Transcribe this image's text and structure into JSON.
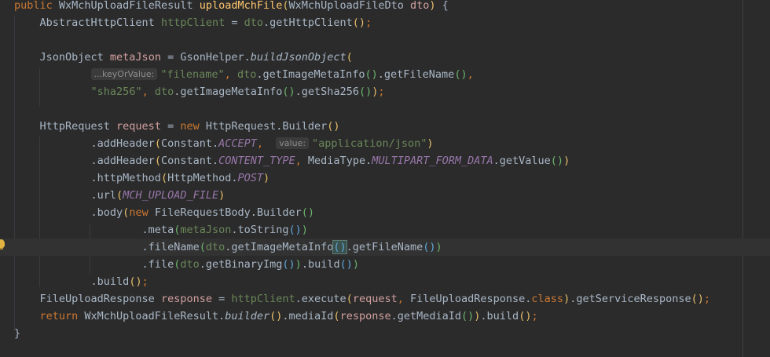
{
  "editor": {
    "lines": [
      {
        "tokens": [
          {
            "t": "public ",
            "c": "kw"
          },
          {
            "t": "WxMchUploadFileResult ",
            "c": "var"
          },
          {
            "t": "uploadMchFile",
            "c": "fn"
          },
          {
            "t": "(",
            "c": "p1"
          },
          {
            "t": "WxMchUploadFileDto ",
            "c": "var"
          },
          {
            "t": "dto",
            "c": "local"
          },
          {
            "t": ")",
            "c": "p1"
          },
          {
            "t": " {",
            "c": "var"
          }
        ]
      },
      {
        "tokens": [
          {
            "t": "    AbstractHttpClient ",
            "c": "var"
          },
          {
            "t": "httpClient",
            "c": "str"
          },
          {
            "t": " = ",
            "c": "var"
          },
          {
            "t": "dto",
            "c": "str"
          },
          {
            "t": ".getHttpClient",
            "c": "var"
          },
          {
            "t": "()",
            "c": "p1"
          },
          {
            "t": ";",
            "c": "kw"
          }
        ]
      },
      {
        "tokens": []
      },
      {
        "tokens": [
          {
            "t": "    JsonObject ",
            "c": "var"
          },
          {
            "t": "metaJson",
            "c": "local"
          },
          {
            "t": " = GsonHelper.",
            "c": "var"
          },
          {
            "t": "buildJsonObject",
            "c": "static"
          },
          {
            "t": "(",
            "c": "p1"
          }
        ]
      },
      {
        "tokens": [
          {
            "t": "            ",
            "c": "var"
          },
          {
            "t": "...keyOrValue:",
            "c": "hint"
          },
          {
            "t": "\"filename\"",
            "c": "str"
          },
          {
            "t": ", ",
            "c": "kw"
          },
          {
            "t": "dto",
            "c": "str"
          },
          {
            "t": ".getImageMetaInfo",
            "c": "var"
          },
          {
            "t": "()",
            "c": "p2"
          },
          {
            "t": ".getFileName",
            "c": "var"
          },
          {
            "t": "()",
            "c": "p2"
          },
          {
            "t": ",",
            "c": "kw"
          }
        ]
      },
      {
        "tokens": [
          {
            "t": "            ",
            "c": "var"
          },
          {
            "t": "\"sha256\"",
            "c": "str"
          },
          {
            "t": ", ",
            "c": "kw"
          },
          {
            "t": "dto",
            "c": "str"
          },
          {
            "t": ".getImageMetaInfo",
            "c": "var"
          },
          {
            "t": "()",
            "c": "p2"
          },
          {
            "t": ".getSha256",
            "c": "var"
          },
          {
            "t": "()",
            "c": "p2"
          },
          {
            "t": ")",
            "c": "p1"
          },
          {
            "t": ";",
            "c": "kw"
          }
        ]
      },
      {
        "tokens": []
      },
      {
        "tokens": [
          {
            "t": "    HttpRequest ",
            "c": "var"
          },
          {
            "t": "request",
            "c": "local"
          },
          {
            "t": " = ",
            "c": "var"
          },
          {
            "t": "new ",
            "c": "kw"
          },
          {
            "t": "HttpRequest.Builder",
            "c": "var"
          },
          {
            "t": "()",
            "c": "p1"
          }
        ]
      },
      {
        "tokens": [
          {
            "t": "            .addHeader",
            "c": "var"
          },
          {
            "t": "(",
            "c": "p1"
          },
          {
            "t": "Constant.",
            "c": "var"
          },
          {
            "t": "ACCEPT",
            "c": "const"
          },
          {
            "t": ",  ",
            "c": "kw"
          },
          {
            "t": "value:",
            "c": "hint"
          },
          {
            "t": "\"application/json\"",
            "c": "str"
          },
          {
            "t": ")",
            "c": "p1"
          }
        ]
      },
      {
        "tokens": [
          {
            "t": "            .addHeader",
            "c": "var"
          },
          {
            "t": "(",
            "c": "p1"
          },
          {
            "t": "Constant.",
            "c": "var"
          },
          {
            "t": "CONTENT_TYPE",
            "c": "const"
          },
          {
            "t": ", ",
            "c": "kw"
          },
          {
            "t": "MediaType.",
            "c": "var"
          },
          {
            "t": "MULTIPART_FORM_DATA",
            "c": "const"
          },
          {
            "t": ".getValue",
            "c": "var"
          },
          {
            "t": "()",
            "c": "p2"
          },
          {
            "t": ")",
            "c": "p1"
          }
        ]
      },
      {
        "tokens": [
          {
            "t": "            .httpMethod",
            "c": "var"
          },
          {
            "t": "(",
            "c": "p1"
          },
          {
            "t": "HttpMethod.",
            "c": "var"
          },
          {
            "t": "POST",
            "c": "const"
          },
          {
            "t": ")",
            "c": "p1"
          }
        ]
      },
      {
        "tokens": [
          {
            "t": "            .url",
            "c": "var"
          },
          {
            "t": "(",
            "c": "p1"
          },
          {
            "t": "MCH_UPLOAD_FILE",
            "c": "const"
          },
          {
            "t": ")",
            "c": "p1"
          }
        ]
      },
      {
        "tokens": [
          {
            "t": "            .body",
            "c": "var"
          },
          {
            "t": "(",
            "c": "p1"
          },
          {
            "t": "new ",
            "c": "kw"
          },
          {
            "t": "FileRequestBody.Builder",
            "c": "var"
          },
          {
            "t": "()",
            "c": "p2"
          }
        ]
      },
      {
        "tokens": [
          {
            "t": "                    .meta",
            "c": "var"
          },
          {
            "t": "(",
            "c": "p2"
          },
          {
            "t": "metaJson",
            "c": "str"
          },
          {
            "t": ".toString",
            "c": "var"
          },
          {
            "t": "()",
            "c": "p3"
          },
          {
            "t": ")",
            "c": "p2"
          }
        ]
      },
      {
        "current": true,
        "tokens": [
          {
            "t": "                    .fileName",
            "c": "var"
          },
          {
            "t": "(",
            "c": "p2"
          },
          {
            "t": "dto",
            "c": "str"
          },
          {
            "t": ".getImageMetaInfo",
            "c": "var"
          },
          {
            "t": "()",
            "c": "p3 caret-match"
          },
          {
            "t": ".getFileName",
            "c": "var"
          },
          {
            "t": "()",
            "c": "p3"
          },
          {
            "t": ")",
            "c": "p2"
          }
        ]
      },
      {
        "tokens": [
          {
            "t": "                    .file",
            "c": "var"
          },
          {
            "t": "(",
            "c": "p2"
          },
          {
            "t": "dto",
            "c": "str"
          },
          {
            "t": ".getBinaryImg",
            "c": "var"
          },
          {
            "t": "()",
            "c": "p3"
          },
          {
            "t": ")",
            "c": "p2"
          },
          {
            "t": ".build",
            "c": "var"
          },
          {
            "t": "()",
            "c": "p3"
          },
          {
            "t": ")",
            "c": "p2"
          }
        ]
      },
      {
        "tokens": [
          {
            "t": "            .build",
            "c": "var"
          },
          {
            "t": "()",
            "c": "p1"
          },
          {
            "t": ";",
            "c": "kw"
          }
        ]
      },
      {
        "tokens": [
          {
            "t": "    FileUploadResponse ",
            "c": "var"
          },
          {
            "t": "response",
            "c": "local"
          },
          {
            "t": " = ",
            "c": "var"
          },
          {
            "t": "httpClient",
            "c": "str"
          },
          {
            "t": ".execute",
            "c": "var"
          },
          {
            "t": "(",
            "c": "p1"
          },
          {
            "t": "request",
            "c": "local"
          },
          {
            "t": ", ",
            "c": "kw"
          },
          {
            "t": "FileUploadResponse.",
            "c": "var"
          },
          {
            "t": "class",
            "c": "kw"
          },
          {
            "t": ")",
            "c": "p1"
          },
          {
            "t": ".getServiceResponse",
            "c": "var"
          },
          {
            "t": "()",
            "c": "p1"
          },
          {
            "t": ";",
            "c": "kw"
          }
        ]
      },
      {
        "tokens": [
          {
            "t": "    return ",
            "c": "kw"
          },
          {
            "t": "WxMchUploadFileResult.",
            "c": "var"
          },
          {
            "t": "builder",
            "c": "static"
          },
          {
            "t": "()",
            "c": "p1"
          },
          {
            "t": ".mediaId",
            "c": "var"
          },
          {
            "t": "(",
            "c": "p1"
          },
          {
            "t": "response",
            "c": "local"
          },
          {
            "t": ".getMediaId",
            "c": "var"
          },
          {
            "t": "()",
            "c": "p2"
          },
          {
            "t": ")",
            "c": "p1"
          },
          {
            "t": ".build",
            "c": "var"
          },
          {
            "t": "()",
            "c": "p1"
          },
          {
            "t": ";",
            "c": "kw"
          }
        ]
      },
      {
        "tokens": [
          {
            "t": "}",
            "c": "var"
          }
        ]
      }
    ]
  }
}
